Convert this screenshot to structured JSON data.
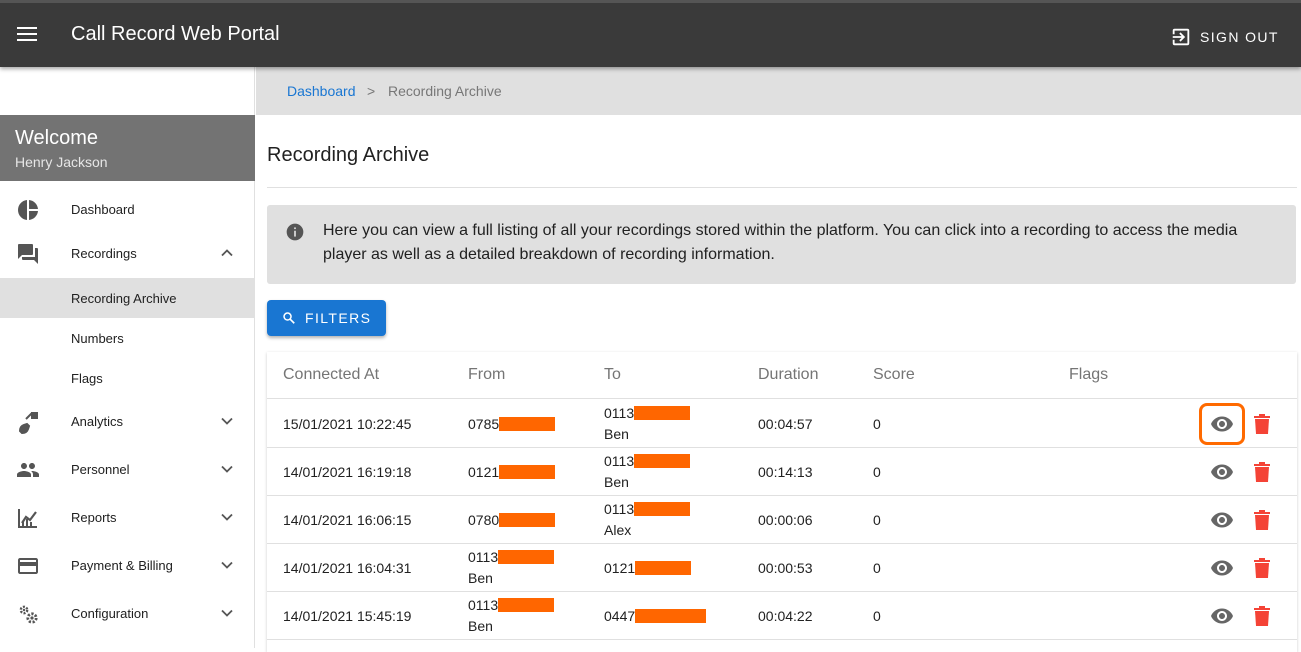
{
  "app": {
    "title": "Call Record Web Portal",
    "sign_out": "SIGN OUT"
  },
  "user": {
    "welcome": "Welcome",
    "name": "Henry Jackson"
  },
  "sidebar": {
    "items": [
      {
        "label": "Dashboard",
        "icon": "pie-chart-icon"
      },
      {
        "label": "Recordings",
        "icon": "chat-icon",
        "expanded": true,
        "children": [
          {
            "label": "Recording Archive",
            "active": true
          },
          {
            "label": "Numbers"
          },
          {
            "label": "Flags"
          }
        ]
      },
      {
        "label": "Analytics",
        "icon": "analytics-icon"
      },
      {
        "label": "Personnel",
        "icon": "people-icon"
      },
      {
        "label": "Reports",
        "icon": "reports-icon"
      },
      {
        "label": "Payment & Billing",
        "icon": "credit-card-icon"
      },
      {
        "label": "Configuration",
        "icon": "gears-icon"
      }
    ]
  },
  "breadcrumb": {
    "link": "Dashboard",
    "separator": ">",
    "current": "Recording Archive"
  },
  "page": {
    "title": "Recording Archive",
    "info": "Here you can view a full listing of all your recordings stored within the platform. You can click into a recording to access the media player as well as a detailed breakdown of recording information.",
    "filters_label": "FILTERS"
  },
  "table": {
    "columns": [
      "Connected At",
      "From",
      "To",
      "Duration",
      "Score",
      "Flags"
    ],
    "rows": [
      {
        "connected_at": "15/01/2021 10:22:45",
        "from": "0785",
        "from_name": "",
        "to": "0113",
        "to_name": "Ben",
        "duration": "00:04:57",
        "score": "0",
        "highlighted": true
      },
      {
        "connected_at": "14/01/2021 16:19:18",
        "from": "0121",
        "from_name": "",
        "to": "0113",
        "to_name": "Ben",
        "duration": "00:14:13",
        "score": "0"
      },
      {
        "connected_at": "14/01/2021 16:06:15",
        "from": "0780",
        "from_name": "",
        "to": "0113",
        "to_name": "Alex",
        "duration": "00:00:06",
        "score": "0"
      },
      {
        "connected_at": "14/01/2021 16:04:31",
        "from": "0113",
        "from_name": "Ben",
        "to": "0121",
        "to_name": "",
        "duration": "00:00:53",
        "score": "0"
      },
      {
        "connected_at": "14/01/2021 15:45:19",
        "from": "0113",
        "from_name": "Ben",
        "to": "0447",
        "to_name": "",
        "duration": "00:04:22",
        "score": "0"
      }
    ]
  },
  "colors": {
    "topbar": "#3a3a3a",
    "primary": "#1976d2",
    "redaction": "#ff6600",
    "delete": "#f44336",
    "highlight": "#ff6a00"
  }
}
